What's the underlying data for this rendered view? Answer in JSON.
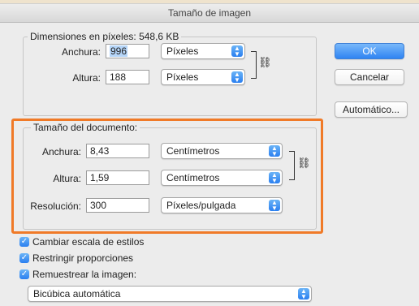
{
  "dialog": {
    "title": "Tamaño de imagen"
  },
  "pixel_dimensions": {
    "title": "Dimensiones en píxeles: 548,6 KB",
    "width_label": "Anchura:",
    "width_value": "996",
    "width_unit": "Píxeles",
    "height_label": "Altura:",
    "height_value": "188",
    "height_unit": "Píxeles"
  },
  "document_size": {
    "title": "Tamaño del documento:",
    "width_label": "Anchura:",
    "width_value": "8,43",
    "width_unit": "Centímetros",
    "height_label": "Altura:",
    "height_value": "1,59",
    "height_unit": "Centímetros",
    "resolution_label": "Resolución:",
    "resolution_value": "300",
    "resolution_unit": "Píxeles/pulgada"
  },
  "buttons": {
    "ok": "OK",
    "cancel": "Cancelar",
    "auto": "Automático..."
  },
  "options": {
    "scale_styles": "Cambiar escala de estilos",
    "constrain": "Restringir proporciones",
    "resample": "Remuestrear la imagen:",
    "resample_method": "Bicúbica automática"
  },
  "colors": {
    "highlight": "#f07a28",
    "accent": "#2f84f2"
  },
  "icons": {
    "link": "link-chain-icon",
    "dropdown": "updown-arrows-icon",
    "check": "checkmark-icon"
  }
}
